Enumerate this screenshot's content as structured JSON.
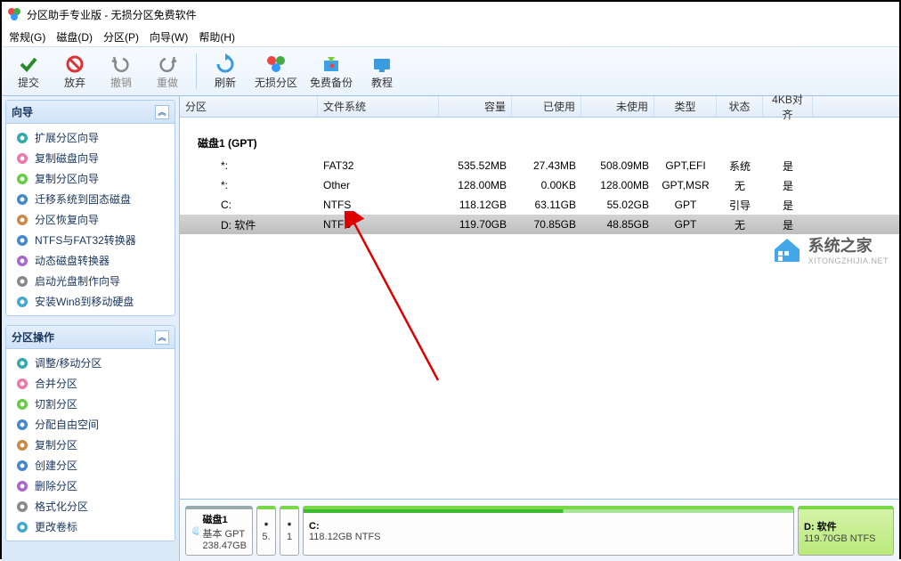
{
  "window": {
    "title": "分区助手专业版 - 无损分区免费软件"
  },
  "menu": {
    "general": "常规(G)",
    "disk": "磁盘(D)",
    "partition": "分区(P)",
    "wizard": "向导(W)",
    "help": "帮助(H)"
  },
  "toolbar": {
    "commit": "提交",
    "discard": "放弃",
    "undo": "撤销",
    "redo": "重做",
    "refresh": "刷新",
    "lossless": "无损分区",
    "backup": "免费备份",
    "tutorial": "教程"
  },
  "sidebar": {
    "wizard_title": "向导",
    "wizard_items": [
      "扩展分区向导",
      "复制磁盘向导",
      "复制分区向导",
      "迁移系统到固态磁盘",
      "分区恢复向导",
      "NTFS与FAT32转换器",
      "动态磁盘转换器",
      "启动光盘制作向导",
      "安装Win8到移动硬盘"
    ],
    "ops_title": "分区操作",
    "ops_items": [
      "调整/移动分区",
      "合并分区",
      "切割分区",
      "分配自由空间",
      "复制分区",
      "创建分区",
      "删除分区",
      "格式化分区",
      "更改卷标"
    ]
  },
  "table": {
    "headers": {
      "partition": "分区",
      "fs": "文件系统",
      "capacity": "容量",
      "used": "已使用",
      "unused": "未使用",
      "type": "类型",
      "state": "状态",
      "align": "4KB对齐"
    },
    "disk_label": "磁盘1 (GPT)",
    "rows": [
      {
        "part": "*:",
        "fs": "FAT32",
        "cap": "535.52MB",
        "used": "27.43MB",
        "unused": "508.09MB",
        "type": "GPT,EFI",
        "state": "系统",
        "align": "是",
        "selected": false
      },
      {
        "part": "*:",
        "fs": "Other",
        "cap": "128.00MB",
        "used": "0.00KB",
        "unused": "128.00MB",
        "type": "GPT,MSR",
        "state": "无",
        "align": "是",
        "selected": false
      },
      {
        "part": "C:",
        "fs": "NTFS",
        "cap": "118.12GB",
        "used": "63.11GB",
        "unused": "55.02GB",
        "type": "GPT",
        "state": "引导",
        "align": "是",
        "selected": false
      },
      {
        "part": "D: 软件",
        "fs": "NTFS",
        "cap": "119.70GB",
        "used": "70.85GB",
        "unused": "48.85GB",
        "type": "GPT",
        "state": "无",
        "align": "是",
        "selected": true
      }
    ]
  },
  "watermark": {
    "main": "系统之家",
    "sub": "XITONGZHIJIA.NET"
  },
  "diskmap": {
    "disk": {
      "name": "磁盘1",
      "sub1": "基本 GPT",
      "sub2": "238.47GB"
    },
    "p1": {
      "name": "*",
      "sub": "5."
    },
    "p2": {
      "name": "*",
      "sub": "1"
    },
    "c": {
      "name": "C:",
      "sub": "118.12GB NTFS"
    },
    "d": {
      "name": "D: 软件",
      "sub": "119.70GB NTFS"
    }
  }
}
